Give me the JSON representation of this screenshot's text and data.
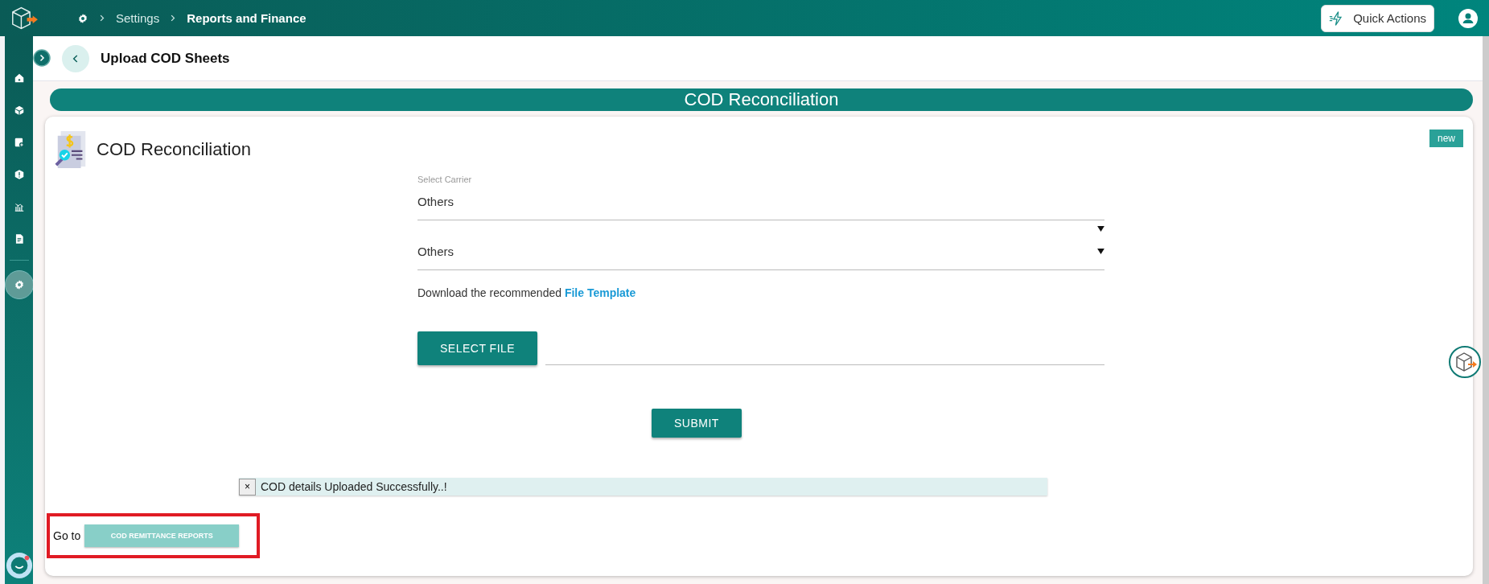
{
  "topbar": {
    "breadcrumbs": [
      {
        "label": "Settings",
        "current": false
      },
      {
        "label": "Reports and Finance",
        "current": true
      }
    ],
    "quick_actions": "Quick Actions"
  },
  "sidebar": {
    "items": [
      {
        "kind": "home",
        "selected": false
      },
      {
        "kind": "box",
        "selected": false
      },
      {
        "kind": "add-doc",
        "selected": false
      },
      {
        "kind": "alert",
        "selected": false
      },
      {
        "kind": "chart",
        "selected": false
      },
      {
        "kind": "file",
        "selected": false
      },
      {
        "kind": "settings",
        "selected": true
      }
    ]
  },
  "page": {
    "title": "Upload COD Sheets"
  },
  "banner": "COD Reconciliation",
  "card": {
    "title": "COD Reconciliation",
    "badge": "new",
    "carrier": {
      "label": "Select Carrier",
      "value": "Others"
    },
    "second_select": {
      "value": "Others"
    },
    "template": {
      "text": "Download the recommended",
      "link": "File Template"
    },
    "select_file": "SELECT FILE",
    "submit": "SUBMIT",
    "alert": {
      "close": "×",
      "message": "COD details Uploaded Successfully..!"
    },
    "goto": {
      "label": "Go to",
      "button": "COD REMITTANCE REPORTS",
      "disabled": true
    }
  }
}
